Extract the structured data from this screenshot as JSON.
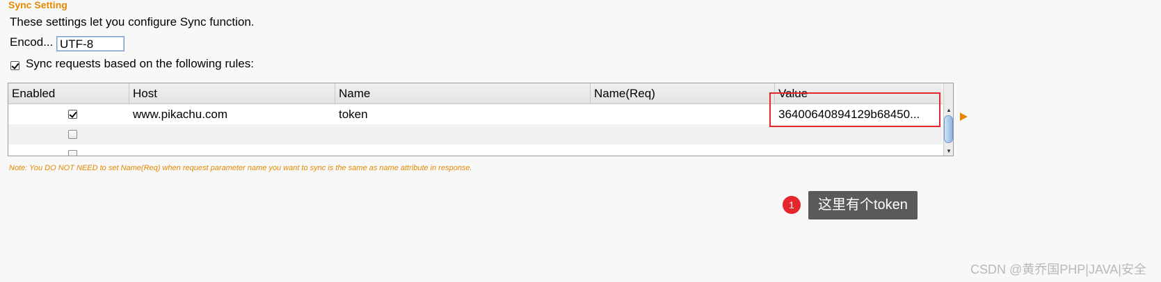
{
  "section_title": "Sync Setting",
  "description": "These settings let you configure Sync function.",
  "encoding": {
    "label": "Encod...",
    "value": "UTF-8"
  },
  "sync_rules": {
    "label": "Sync requests based on the following rules:",
    "checked": true
  },
  "table": {
    "columns": [
      "Enabled",
      "Host",
      "Name",
      "Name(Req)",
      "Value"
    ],
    "rows": [
      {
        "enabled": true,
        "host": "www.pikachu.com",
        "name": "token",
        "name_req": "",
        "value": "36400640894129b68450..."
      },
      {
        "enabled": false,
        "host": "",
        "name": "",
        "name_req": "",
        "value": ""
      },
      {
        "enabled": false,
        "host": "",
        "name": "",
        "name_req": "",
        "value": ""
      }
    ]
  },
  "note": "Note: You DO NOT NEED to set Name(Req) when request parameter name you want to sync is the same as name attribute in response.",
  "annotation": {
    "badge": "1",
    "text": "这里有个token"
  },
  "watermark": "CSDN @黄乔国PHP|JAVA|安全",
  "colors": {
    "accent": "#e58900",
    "highlight": "#e5262c"
  }
}
